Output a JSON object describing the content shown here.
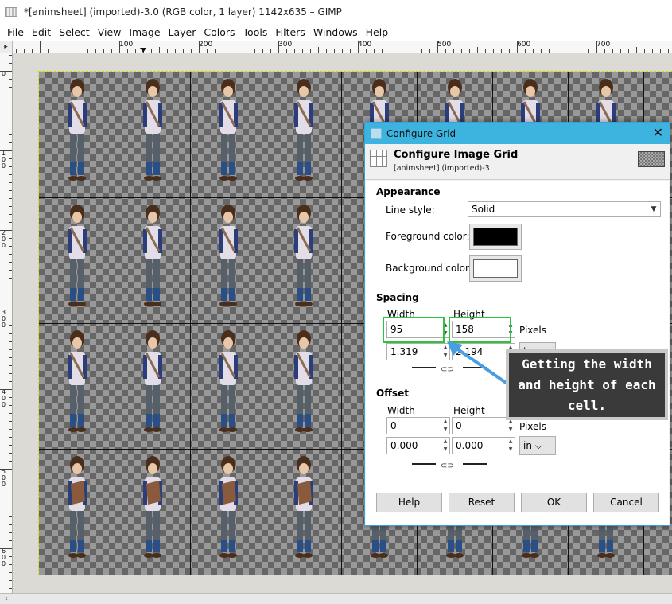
{
  "window": {
    "title": "*[animsheet] (imported)-3.0 (RGB color, 1 layer) 1142x635 – GIMP"
  },
  "menubar": [
    "File",
    "Edit",
    "Select",
    "View",
    "Image",
    "Layer",
    "Colors",
    "Tools",
    "Filters",
    "Windows",
    "Help"
  ],
  "ruler": {
    "h_labels": [
      "100",
      "200",
      "300",
      "400",
      "500",
      "600",
      "700"
    ],
    "v_labels": [
      "0",
      "100",
      "200",
      "300",
      "400",
      "500",
      "600"
    ]
  },
  "dialog": {
    "window_title": "Configure Grid",
    "close_glyph": "✕",
    "header_title": "Configure Image Grid",
    "header_subtitle": "[animsheet] (imported)-3",
    "appearance": {
      "section": "Appearance",
      "line_style_label": "Line style:",
      "line_style_value": "Solid",
      "fg_label": "Foreground color:",
      "fg_color": "#000000",
      "bg_label": "Background color:",
      "bg_color": "#ffffff"
    },
    "spacing": {
      "section": "Spacing",
      "width_label": "Width",
      "height_label": "Height",
      "width_px": "95",
      "height_px": "158",
      "unit_px": "Pixels",
      "width_in": "1.319",
      "height_in": "2.194",
      "unit_in": "in"
    },
    "offset": {
      "section": "Offset",
      "width_label": "Width",
      "height_label": "Height",
      "width_px": "0",
      "height_px": "0",
      "unit_px": "Pixels",
      "width_in": "0.000",
      "height_in": "0.000",
      "unit_in": "in"
    },
    "buttons": {
      "help": "Help",
      "reset": "Reset",
      "ok": "OK",
      "cancel": "Cancel"
    }
  },
  "annotation": {
    "text": "Getting the width and height of each cell.",
    "highlight_color": "#2bc53b",
    "arrow_color": "#4a9de0"
  }
}
